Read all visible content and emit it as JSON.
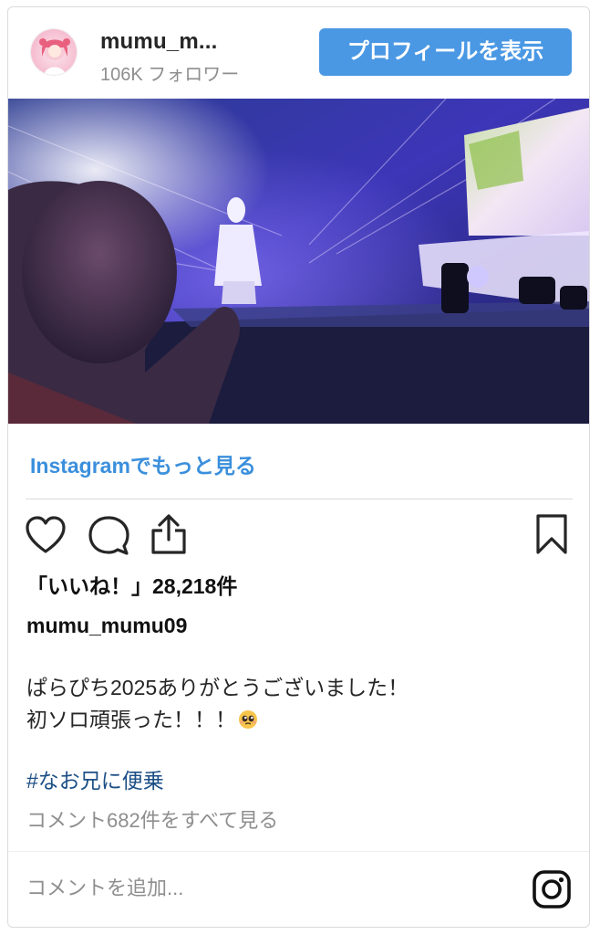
{
  "header": {
    "username_short": "mumu_m...",
    "followers": "106K フォロワー",
    "profile_button": "プロフィールを表示"
  },
  "post": {
    "more_link": "Instagramでもっと見る",
    "likes": "「いいね！」28,218件",
    "owner": "mumu_mumu09",
    "caption_line1": "ぱらぴち2025ありがとうございました！",
    "caption_line2": "初ソロ頑張った！！！",
    "caption_emoji": "pleading-face-emoji",
    "hashtag": "#なお兄に便乗",
    "view_comments": "コメント682件をすべて見る"
  },
  "comment": {
    "placeholder": "コメントを追加..."
  },
  "icons": {
    "like": "heart-icon",
    "comment": "comment-bubble-icon",
    "share": "share-icon",
    "save": "bookmark-icon",
    "brand": "instagram-icon"
  },
  "colors": {
    "accent": "#4a98e4",
    "link": "#3b8fdc",
    "hashtag": "#1c4f86",
    "muted": "#8e8e8e"
  }
}
